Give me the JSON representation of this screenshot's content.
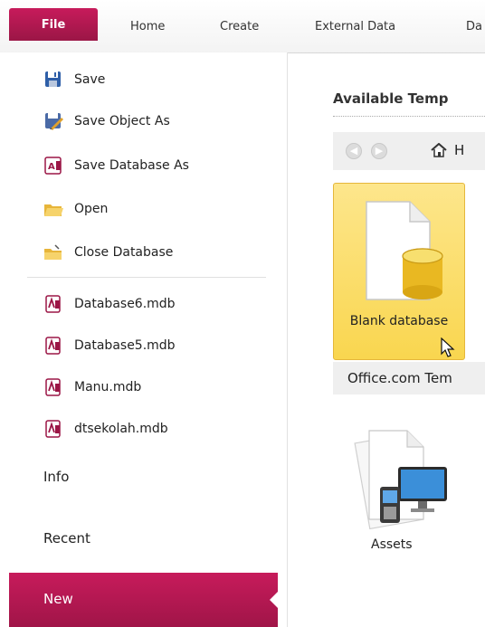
{
  "ribbon": {
    "tabs": [
      {
        "label": "File"
      },
      {
        "label": "Home"
      },
      {
        "label": "Create"
      },
      {
        "label": "External Data"
      },
      {
        "label": "Da"
      }
    ]
  },
  "backstage": {
    "commands": [
      {
        "label": "Save",
        "icon": "save-icon"
      },
      {
        "label": "Save Object As",
        "icon": "save-object-as-icon"
      },
      {
        "label": "Save Database As",
        "icon": "save-database-as-icon"
      },
      {
        "label": "Open",
        "icon": "open-folder-icon"
      },
      {
        "label": "Close Database",
        "icon": "close-database-icon"
      }
    ],
    "recent_files": [
      {
        "label": "Database6.mdb"
      },
      {
        "label": "Database5.mdb"
      },
      {
        "label": "Manu.mdb"
      },
      {
        "label": "dtsekolah.mdb"
      }
    ],
    "nav": {
      "info": "Info",
      "recent": "Recent",
      "new": "New"
    }
  },
  "content": {
    "available_title": "Available Temp",
    "home_label": "H",
    "blank_database_label": "Blank database",
    "office_templates_label": "Office.com Tem",
    "assets_label": "Assets"
  },
  "colors": {
    "accent": "#b3174f",
    "tile_highlight": "#f9d64f"
  }
}
